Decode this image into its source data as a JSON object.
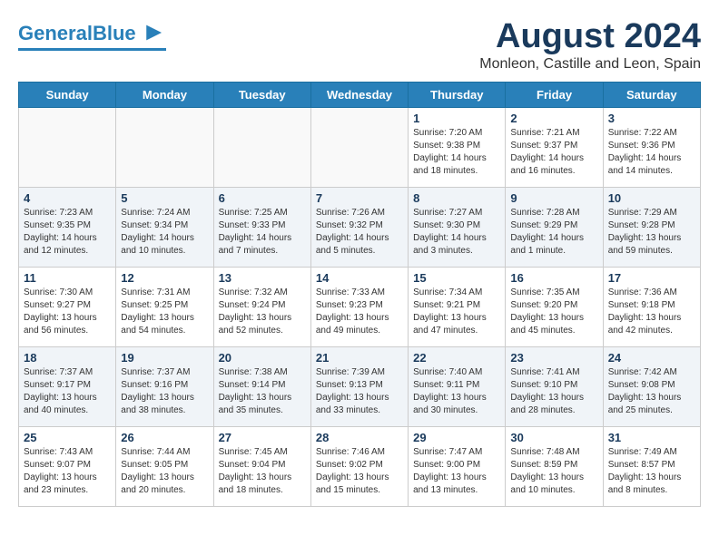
{
  "header": {
    "logo_line1": "General",
    "logo_line2": "Blue",
    "month_year": "August 2024",
    "location": "Monleon, Castille and Leon, Spain"
  },
  "weekdays": [
    "Sunday",
    "Monday",
    "Tuesday",
    "Wednesday",
    "Thursday",
    "Friday",
    "Saturday"
  ],
  "weeks": [
    [
      {
        "day": "",
        "empty": true
      },
      {
        "day": "",
        "empty": true
      },
      {
        "day": "",
        "empty": true
      },
      {
        "day": "",
        "empty": true
      },
      {
        "day": "1",
        "sunrise": "7:20 AM",
        "sunset": "9:38 PM",
        "daylight": "14 hours and 18 minutes"
      },
      {
        "day": "2",
        "sunrise": "7:21 AM",
        "sunset": "9:37 PM",
        "daylight": "14 hours and 16 minutes"
      },
      {
        "day": "3",
        "sunrise": "7:22 AM",
        "sunset": "9:36 PM",
        "daylight": "14 hours and 14 minutes"
      }
    ],
    [
      {
        "day": "4",
        "sunrise": "7:23 AM",
        "sunset": "9:35 PM",
        "daylight": "14 hours and 12 minutes"
      },
      {
        "day": "5",
        "sunrise": "7:24 AM",
        "sunset": "9:34 PM",
        "daylight": "14 hours and 10 minutes"
      },
      {
        "day": "6",
        "sunrise": "7:25 AM",
        "sunset": "9:33 PM",
        "daylight": "14 hours and 7 minutes"
      },
      {
        "day": "7",
        "sunrise": "7:26 AM",
        "sunset": "9:32 PM",
        "daylight": "14 hours and 5 minutes"
      },
      {
        "day": "8",
        "sunrise": "7:27 AM",
        "sunset": "9:30 PM",
        "daylight": "14 hours and 3 minutes"
      },
      {
        "day": "9",
        "sunrise": "7:28 AM",
        "sunset": "9:29 PM",
        "daylight": "14 hours and 1 minute"
      },
      {
        "day": "10",
        "sunrise": "7:29 AM",
        "sunset": "9:28 PM",
        "daylight": "13 hours and 59 minutes"
      }
    ],
    [
      {
        "day": "11",
        "sunrise": "7:30 AM",
        "sunset": "9:27 PM",
        "daylight": "13 hours and 56 minutes"
      },
      {
        "day": "12",
        "sunrise": "7:31 AM",
        "sunset": "9:25 PM",
        "daylight": "13 hours and 54 minutes"
      },
      {
        "day": "13",
        "sunrise": "7:32 AM",
        "sunset": "9:24 PM",
        "daylight": "13 hours and 52 minutes"
      },
      {
        "day": "14",
        "sunrise": "7:33 AM",
        "sunset": "9:23 PM",
        "daylight": "13 hours and 49 minutes"
      },
      {
        "day": "15",
        "sunrise": "7:34 AM",
        "sunset": "9:21 PM",
        "daylight": "13 hours and 47 minutes"
      },
      {
        "day": "16",
        "sunrise": "7:35 AM",
        "sunset": "9:20 PM",
        "daylight": "13 hours and 45 minutes"
      },
      {
        "day": "17",
        "sunrise": "7:36 AM",
        "sunset": "9:18 PM",
        "daylight": "13 hours and 42 minutes"
      }
    ],
    [
      {
        "day": "18",
        "sunrise": "7:37 AM",
        "sunset": "9:17 PM",
        "daylight": "13 hours and 40 minutes"
      },
      {
        "day": "19",
        "sunrise": "7:37 AM",
        "sunset": "9:16 PM",
        "daylight": "13 hours and 38 minutes"
      },
      {
        "day": "20",
        "sunrise": "7:38 AM",
        "sunset": "9:14 PM",
        "daylight": "13 hours and 35 minutes"
      },
      {
        "day": "21",
        "sunrise": "7:39 AM",
        "sunset": "9:13 PM",
        "daylight": "13 hours and 33 minutes"
      },
      {
        "day": "22",
        "sunrise": "7:40 AM",
        "sunset": "9:11 PM",
        "daylight": "13 hours and 30 minutes"
      },
      {
        "day": "23",
        "sunrise": "7:41 AM",
        "sunset": "9:10 PM",
        "daylight": "13 hours and 28 minutes"
      },
      {
        "day": "24",
        "sunrise": "7:42 AM",
        "sunset": "9:08 PM",
        "daylight": "13 hours and 25 minutes"
      }
    ],
    [
      {
        "day": "25",
        "sunrise": "7:43 AM",
        "sunset": "9:07 PM",
        "daylight": "13 hours and 23 minutes"
      },
      {
        "day": "26",
        "sunrise": "7:44 AM",
        "sunset": "9:05 PM",
        "daylight": "13 hours and 20 minutes"
      },
      {
        "day": "27",
        "sunrise": "7:45 AM",
        "sunset": "9:04 PM",
        "daylight": "13 hours and 18 minutes"
      },
      {
        "day": "28",
        "sunrise": "7:46 AM",
        "sunset": "9:02 PM",
        "daylight": "13 hours and 15 minutes"
      },
      {
        "day": "29",
        "sunrise": "7:47 AM",
        "sunset": "9:00 PM",
        "daylight": "13 hours and 13 minutes"
      },
      {
        "day": "30",
        "sunrise": "7:48 AM",
        "sunset": "8:59 PM",
        "daylight": "13 hours and 10 minutes"
      },
      {
        "day": "31",
        "sunrise": "7:49 AM",
        "sunset": "8:57 PM",
        "daylight": "13 hours and 8 minutes"
      }
    ]
  ]
}
